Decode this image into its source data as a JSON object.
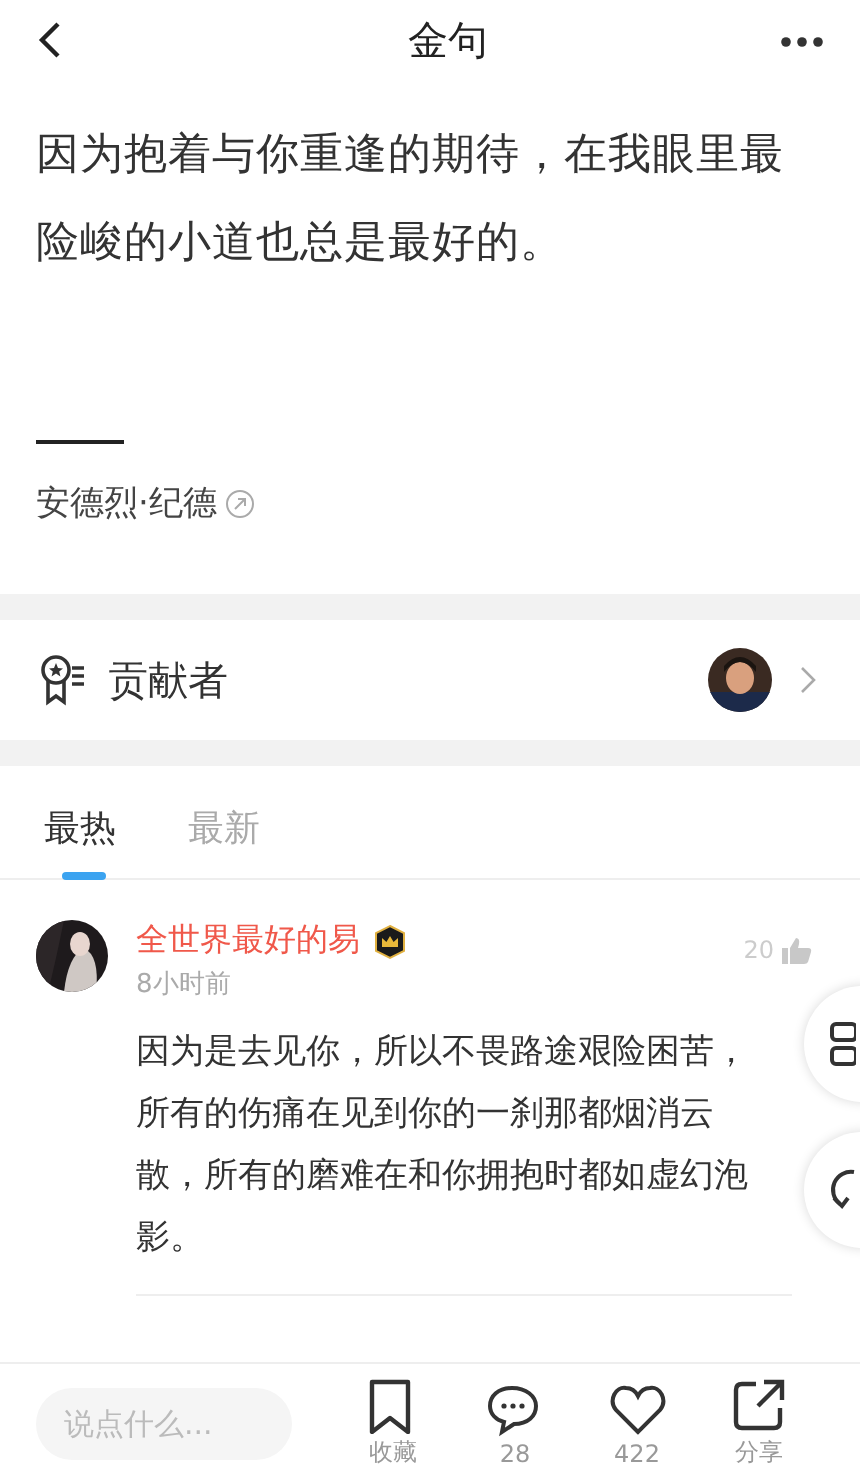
{
  "header": {
    "title": "金句"
  },
  "quote": {
    "text": "因为抱着与你重逢的期待，在我眼里最险峻的小道也总是最好的。",
    "author": "安德烈·纪德"
  },
  "contributors": {
    "label": "贡献者"
  },
  "tabs": [
    {
      "label": "最热",
      "selected": true
    },
    {
      "label": "最新",
      "selected": false
    }
  ],
  "comments": [
    {
      "user": "全世界最好的易",
      "time": "8小时前",
      "likes": "20",
      "text": "因为是去见你，所以不畏路途艰险困苦，所有的伤痛在见到你的一刹那都烟消云散，所有的磨难在和你拥抱时都如虚幻泡影。"
    }
  ],
  "bottom_bar": {
    "placeholder": "说点什么...",
    "actions": [
      {
        "kind": "bookmark",
        "label": "收藏"
      },
      {
        "kind": "comment",
        "label": "28"
      },
      {
        "kind": "like",
        "label": "422"
      },
      {
        "kind": "share",
        "label": "分享"
      }
    ]
  }
}
